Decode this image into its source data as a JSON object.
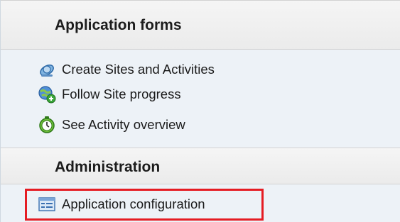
{
  "sections": [
    {
      "title": "Application forms",
      "items": [
        {
          "label": "Create Sites and Activities",
          "icon": "satellite-icon"
        },
        {
          "label": "Follow Site progress",
          "icon": "globe-add-icon"
        },
        {
          "label": "See Activity overview",
          "icon": "clock-icon"
        }
      ]
    },
    {
      "title": "Administration",
      "items": [
        {
          "label": "Application configuration",
          "icon": "form-config-icon",
          "highlighted": true
        }
      ]
    }
  ],
  "colors": {
    "header_bg": "#ebebeb",
    "body_bg": "#edf2f7",
    "highlight_border": "#e51c23"
  }
}
